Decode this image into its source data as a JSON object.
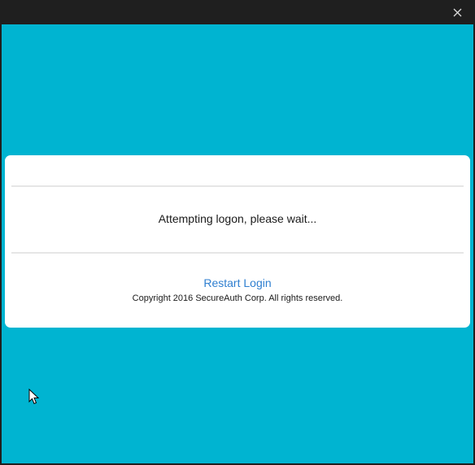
{
  "window": {
    "close_symbol": "✕"
  },
  "card": {
    "status": "Attempting logon, please wait...",
    "restart_label": "Restart Login",
    "copyright": "Copyright 2016 SecureAuth Corp. All rights reserved."
  },
  "colors": {
    "background": "#00b4d1",
    "card": "#ffffff",
    "link": "#2f7fd0",
    "titlebar": "#1f1f1f"
  },
  "icons": {
    "close": "close-icon",
    "cursor": "mouse-pointer-icon"
  }
}
